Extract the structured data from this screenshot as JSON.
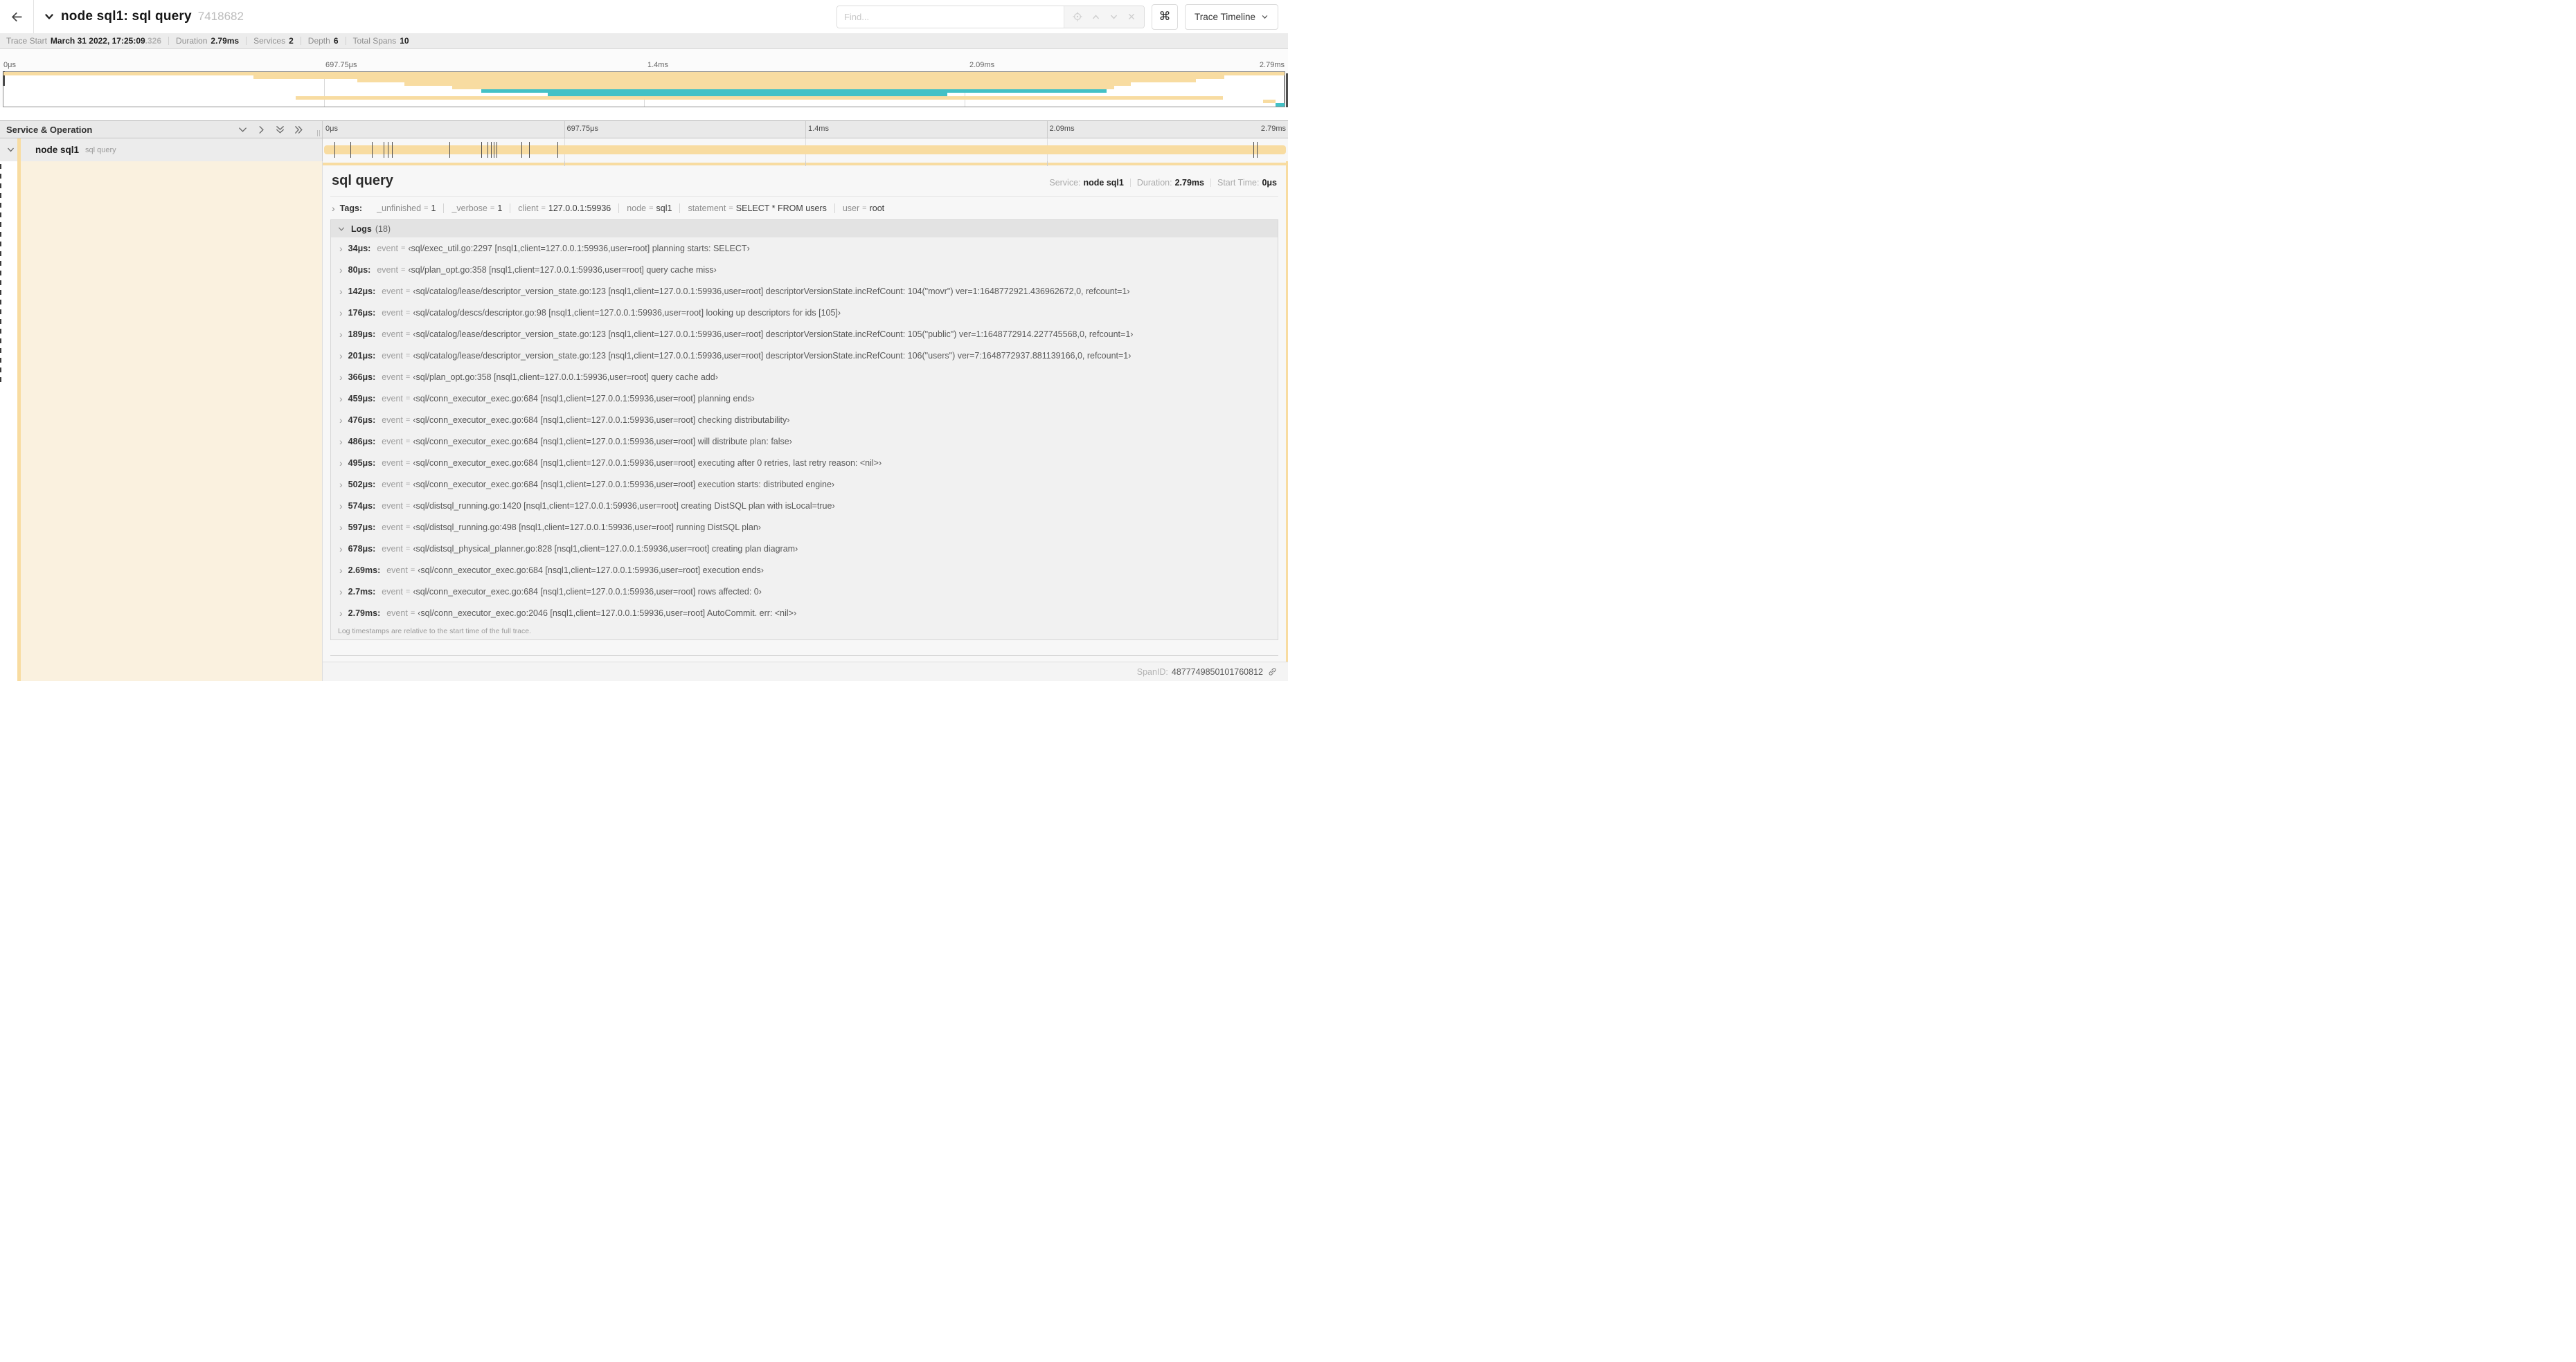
{
  "header": {
    "title": "node sql1: sql query",
    "trace_id_short": "7418682",
    "find_placeholder": "Find...",
    "shortcut_key": "⌘",
    "view_selector_label": "Trace Timeline"
  },
  "summary": {
    "items": [
      {
        "label": "Trace Start",
        "value": "March 31 2022, 17:25:09",
        "suffix": ".326"
      },
      {
        "label": "Duration",
        "value": "2.79ms",
        "suffix": ""
      },
      {
        "label": "Services",
        "value": "2",
        "suffix": ""
      },
      {
        "label": "Depth",
        "value": "6",
        "suffix": ""
      },
      {
        "label": "Total Spans",
        "value": "10",
        "suffix": ""
      }
    ]
  },
  "colors": {
    "tan": "#F8DCA1",
    "teal": "#43C1C6",
    "cream": "#FAF1DF"
  },
  "minimap": {
    "ticks": [
      "0μs",
      "697.75μs",
      "1.4ms",
      "2.09ms",
      "2.79ms"
    ],
    "spans": [
      {
        "row": 0,
        "start": 0,
        "end": 100,
        "color": "tan"
      },
      {
        "row": 1,
        "start": 19.5,
        "end": 95.3,
        "color": "tan"
      },
      {
        "row": 2,
        "start": 27.6,
        "end": 93.1,
        "color": "tan"
      },
      {
        "row": 3,
        "start": 31.3,
        "end": 88.0,
        "color": "tan"
      },
      {
        "row": 4,
        "start": 35.0,
        "end": 86.7,
        "color": "tan"
      },
      {
        "row": 5,
        "start": 37.3,
        "end": 86.1,
        "color": "teal"
      },
      {
        "row": 6,
        "start": 42.5,
        "end": 73.7,
        "color": "teal"
      },
      {
        "row": 7,
        "start": 22.8,
        "end": 95.2,
        "color": "tan"
      },
      {
        "row": 8,
        "start": 98.3,
        "end": 99.3,
        "color": "tan"
      },
      {
        "row": 9,
        "start": 99.3,
        "end": 100,
        "color": "teal"
      }
    ]
  },
  "timeline": {
    "left_header": "Service & Operation",
    "ticks": [
      "0μs",
      "697.75μs",
      "1.4ms",
      "2.09ms",
      "2.79ms"
    ],
    "span_row": {
      "service": "node sql1",
      "operation": "sql query",
      "duration_us": 2790,
      "log_marks_us": [
        34,
        80,
        142,
        176,
        189,
        201,
        366,
        459,
        476,
        486,
        495,
        502,
        574,
        597,
        678,
        2690,
        2700,
        2790
      ]
    }
  },
  "detail": {
    "title": "sql query",
    "meta": [
      {
        "label": "Service:",
        "value": "node sql1"
      },
      {
        "label": "Duration:",
        "value": "2.79ms"
      },
      {
        "label": "Start Time:",
        "value": "0μs"
      }
    ],
    "tags_label": "Tags:",
    "tags": [
      {
        "key": "_unfinished",
        "value": "1"
      },
      {
        "key": "_verbose",
        "value": "1"
      },
      {
        "key": "client",
        "value": "127.0.0.1:59936"
      },
      {
        "key": "node",
        "value": "sql1"
      },
      {
        "key": "statement",
        "value": "SELECT * FROM users"
      },
      {
        "key": "user",
        "value": "root"
      }
    ],
    "logs_label": "Logs",
    "logs_count": "(18)",
    "log_key": "event",
    "logs": [
      {
        "t": "34μs:",
        "msg": "‹sql/exec_util.go:2297 [nsql1,client=127.0.0.1:59936,user=root] planning starts: SELECT›"
      },
      {
        "t": "80μs:",
        "msg": "‹sql/plan_opt.go:358 [nsql1,client=127.0.0.1:59936,user=root] query cache miss›"
      },
      {
        "t": "142μs:",
        "msg": "‹sql/catalog/lease/descriptor_version_state.go:123 [nsql1,client=127.0.0.1:59936,user=root] descriptorVersionState.incRefCount: 104(\"movr\") ver=1:1648772921.436962672,0, refcount=1›"
      },
      {
        "t": "176μs:",
        "msg": "‹sql/catalog/descs/descriptor.go:98 [nsql1,client=127.0.0.1:59936,user=root] looking up descriptors for ids [105]›"
      },
      {
        "t": "189μs:",
        "msg": "‹sql/catalog/lease/descriptor_version_state.go:123 [nsql1,client=127.0.0.1:59936,user=root] descriptorVersionState.incRefCount: 105(\"public\") ver=1:1648772914.227745568,0, refcount=1›"
      },
      {
        "t": "201μs:",
        "msg": "‹sql/catalog/lease/descriptor_version_state.go:123 [nsql1,client=127.0.0.1:59936,user=root] descriptorVersionState.incRefCount: 106(\"users\") ver=7:1648772937.881139166,0, refcount=1›"
      },
      {
        "t": "366μs:",
        "msg": "‹sql/plan_opt.go:358 [nsql1,client=127.0.0.1:59936,user=root] query cache add›"
      },
      {
        "t": "459μs:",
        "msg": "‹sql/conn_executor_exec.go:684 [nsql1,client=127.0.0.1:59936,user=root] planning ends›"
      },
      {
        "t": "476μs:",
        "msg": "‹sql/conn_executor_exec.go:684 [nsql1,client=127.0.0.1:59936,user=root] checking distributability›"
      },
      {
        "t": "486μs:",
        "msg": "‹sql/conn_executor_exec.go:684 [nsql1,client=127.0.0.1:59936,user=root] will distribute plan: false›"
      },
      {
        "t": "495μs:",
        "msg": "‹sql/conn_executor_exec.go:684 [nsql1,client=127.0.0.1:59936,user=root] executing after 0 retries, last retry reason: <nil>›"
      },
      {
        "t": "502μs:",
        "msg": "‹sql/conn_executor_exec.go:684 [nsql1,client=127.0.0.1:59936,user=root] execution starts: distributed engine›"
      },
      {
        "t": "574μs:",
        "msg": "‹sql/distsql_running.go:1420 [nsql1,client=127.0.0.1:59936,user=root] creating DistSQL plan with isLocal=true›"
      },
      {
        "t": "597μs:",
        "msg": "‹sql/distsql_running.go:498 [nsql1,client=127.0.0.1:59936,user=root] running DistSQL plan›"
      },
      {
        "t": "678μs:",
        "msg": "‹sql/distsql_physical_planner.go:828 [nsql1,client=127.0.0.1:59936,user=root] creating plan diagram›"
      },
      {
        "t": "2.69ms:",
        "msg": "‹sql/conn_executor_exec.go:684 [nsql1,client=127.0.0.1:59936,user=root] execution ends›"
      },
      {
        "t": "2.7ms:",
        "msg": "‹sql/conn_executor_exec.go:684 [nsql1,client=127.0.0.1:59936,user=root] rows affected: 0›"
      },
      {
        "t": "2.79ms:",
        "msg": "‹sql/conn_executor_exec.go:2046 [nsql1,client=127.0.0.1:59936,user=root] AutoCommit. err: <nil>›"
      }
    ],
    "logs_footer": "Log timestamps are relative to the start time of the full trace.",
    "span_id_label": "SpanID:",
    "span_id": "4877749850101760812"
  }
}
